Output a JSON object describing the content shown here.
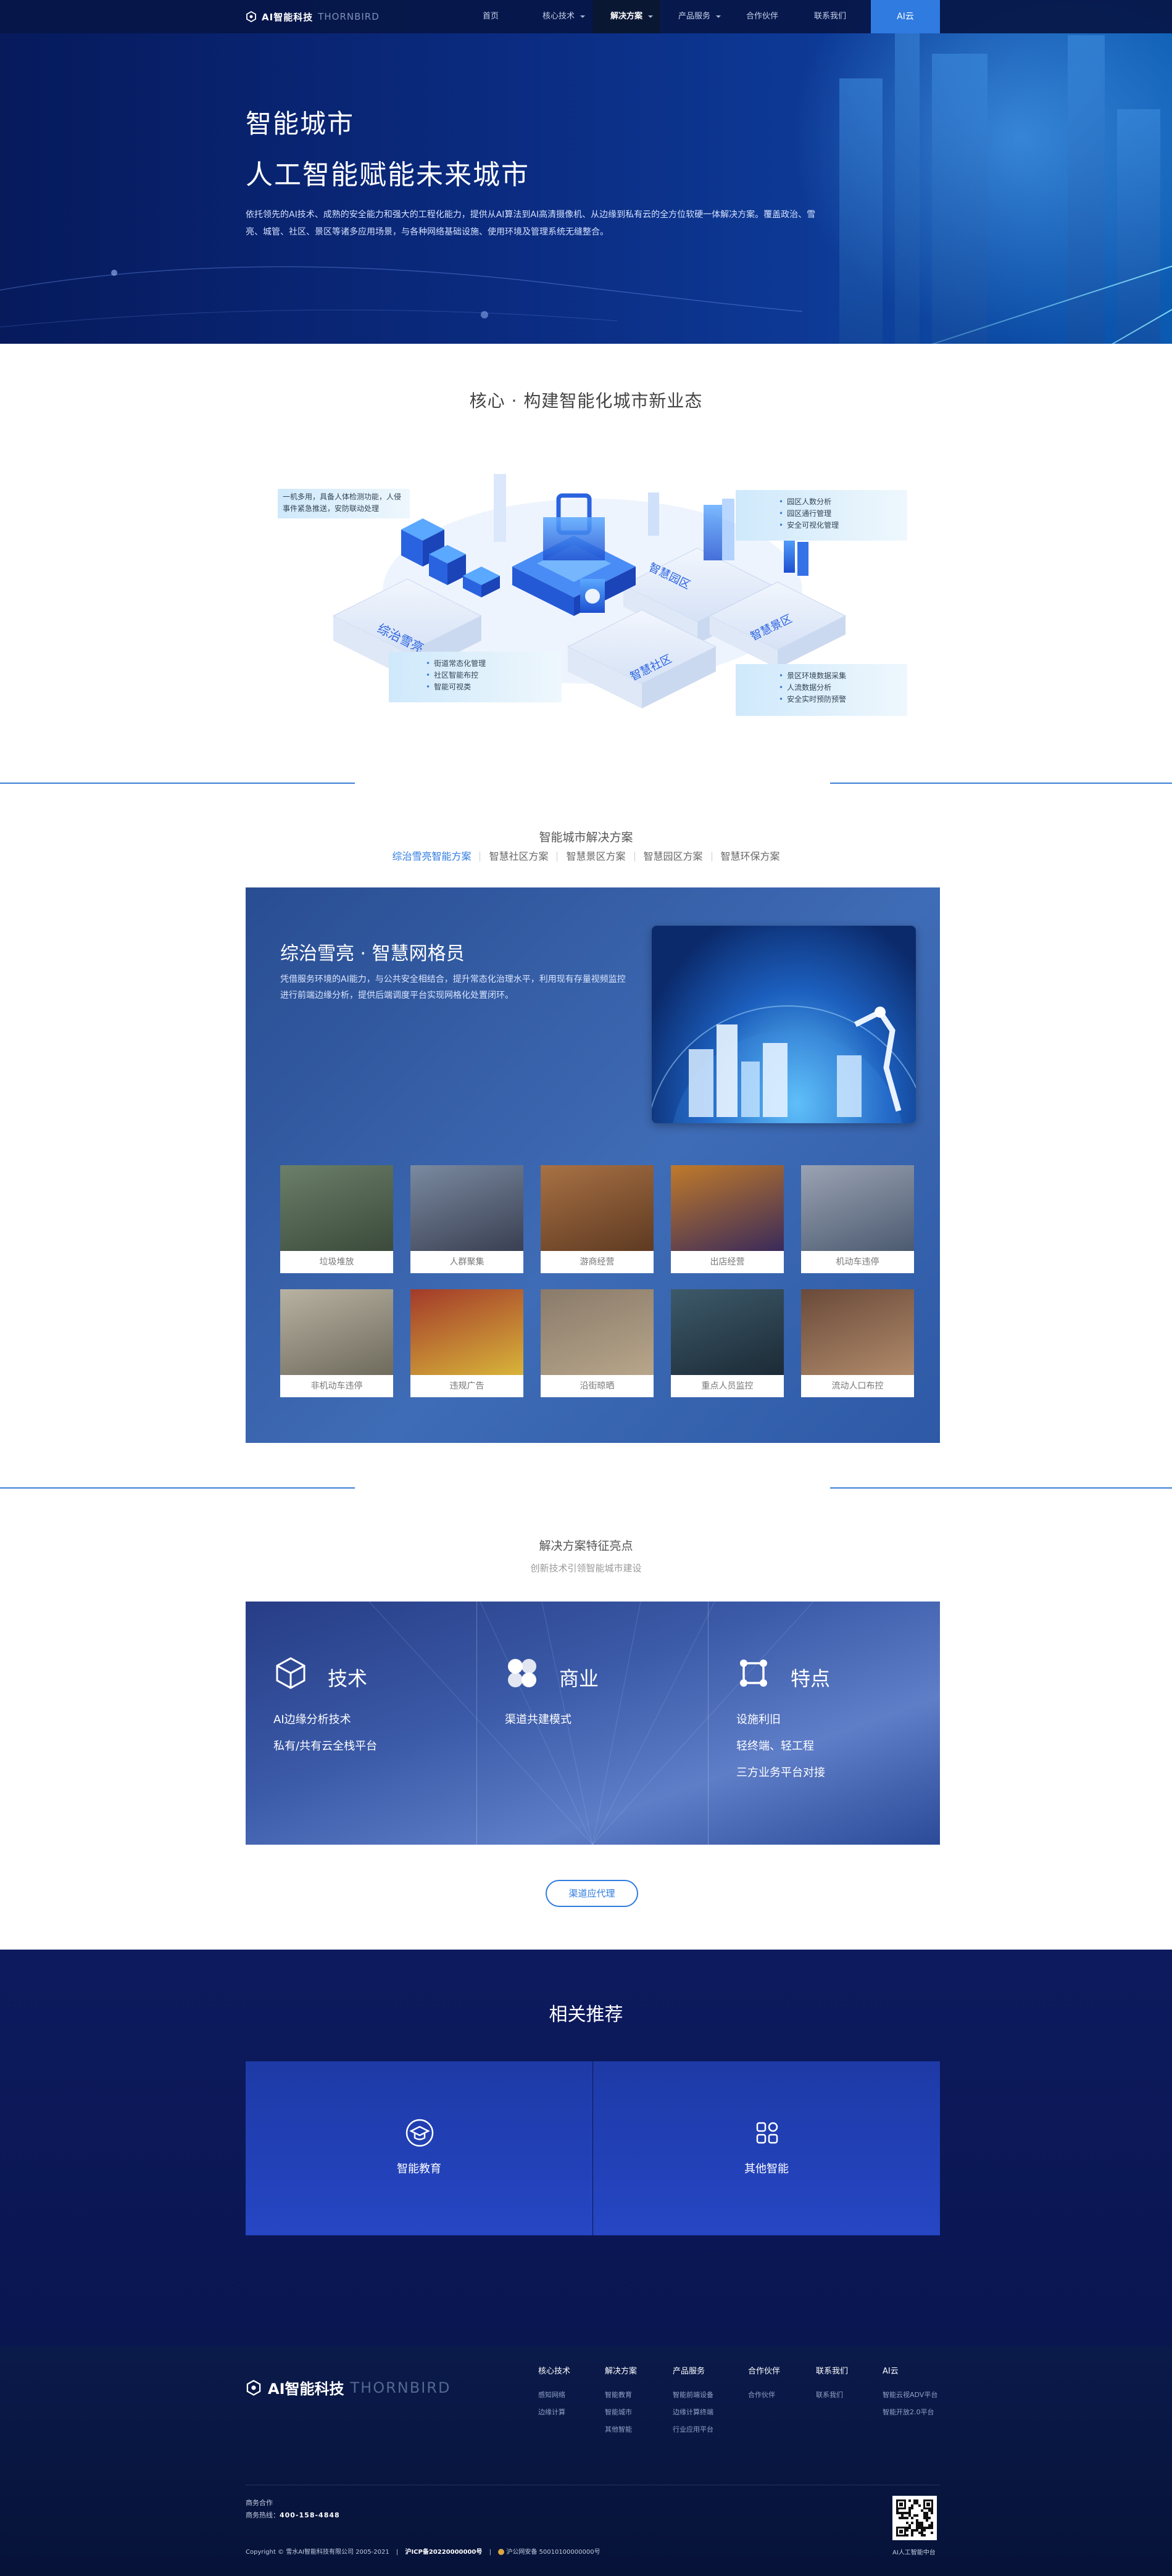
{
  "brand": {
    "name": "AI智能科技",
    "sub": "THORNBIRD"
  },
  "nav": {
    "items": [
      {
        "label": "首页",
        "dropdown": false,
        "active": false
      },
      {
        "label": "核心技术",
        "dropdown": true,
        "active": false
      },
      {
        "label": "解决方案",
        "dropdown": true,
        "active": true
      },
      {
        "label": "产品服务",
        "dropdown": true,
        "active": false
      },
      {
        "label": "合作伙伴",
        "dropdown": false,
        "active": false
      },
      {
        "label": "联系我们",
        "dropdown": false,
        "active": false
      }
    ],
    "cta": "AI云"
  },
  "hero": {
    "title1": "智能城市",
    "title2": "人工智能赋能未来城市",
    "desc": "依托领先的AI技术、成熟的安全能力和强大的工程化能力，提供从AI算法到AI高清摄像机、从边缘到私有云的全方位软硬一体解决方案。覆盖政治、雪亮、城管、社区、景区等诸多应用场景，与各种网络基础设施、使用环境及管理系统无缝整合。"
  },
  "core": {
    "title": "核心 · 构建智能化城市新业态",
    "labels": {
      "a": "综治雪亮",
      "b": "智慧园区",
      "c": "智慧社区",
      "d": "智慧景区"
    },
    "bubble_tl": "一机多用，具备人体检测功能，人侵事件紧急推送，安防联动处理",
    "bubble_tr": [
      "园区人数分析",
      "园区通行管理",
      "安全可视化管理"
    ],
    "bubble_bl": [
      "街道常态化管理",
      "社区智能布控",
      "智能可视类"
    ],
    "bubble_br": [
      "景区环境数据采集",
      "人流数据分析",
      "安全实时预防预警"
    ]
  },
  "solutions": {
    "heading": "智能城市解决方案",
    "tabs": [
      "综治雪亮智能方案",
      "智慧社区方案",
      "智慧景区方案",
      "智慧园区方案",
      "智慧环保方案"
    ],
    "active_tab": 0,
    "card_title": "综治雪亮 · 智慧网格员",
    "card_desc": "凭借服务环境的AI能力，与公共安全相结合，提升常态化治理水平，利用现有存量视频监控进行前端边缘分析，提供后端调度平台实现网格化处置闭环。",
    "items": [
      "垃圾堆放",
      "人群聚集",
      "游商经营",
      "出店经营",
      "机动车违停",
      "非机动车违停",
      "违规广告",
      "沿街晾晒",
      "重点人员监控",
      "流动人口布控"
    ]
  },
  "features": {
    "heading": "解决方案特征亮点",
    "sub": "创新技术引领智能城市建设",
    "cols": [
      {
        "title": "技术",
        "icon": "cube-icon",
        "lines": [
          "AI边缘分析技术",
          "私有/共有云全栈平台"
        ]
      },
      {
        "title": "商业",
        "icon": "clover-icon",
        "lines": [
          "渠道共建模式"
        ]
      },
      {
        "title": "特点",
        "icon": "shield-icon",
        "lines": [
          "设施利旧",
          "轻终端、轻工程",
          "三方业务平台对接"
        ]
      }
    ],
    "button": "渠道应代理"
  },
  "related": {
    "title": "相关推荐",
    "cards": [
      {
        "label": "智能教育",
        "icon": "graduation-icon"
      },
      {
        "label": "其他智能",
        "icon": "apps-icon"
      }
    ]
  },
  "footer": {
    "cols": [
      {
        "title": "核心技术",
        "items": [
          "感知网络",
          "边缘计算"
        ]
      },
      {
        "title": "解决方案",
        "items": [
          "智能教育",
          "智能城市",
          "其他智能"
        ]
      },
      {
        "title": "产品服务",
        "items": [
          "智能前端设备",
          "边缘计算终端",
          "行业应用平台"
        ]
      },
      {
        "title": "合作伙伴",
        "items": [
          "合作伙伴"
        ]
      },
      {
        "title": "联系我们",
        "items": [
          "联系我们"
        ]
      },
      {
        "title": "AI云",
        "items": [
          "智能云视ADV平台",
          "智能开放2.0平台"
        ]
      }
    ],
    "biz_label": "商务合作",
    "hotline_label": "商务热线：",
    "hotline": "400-158-4848",
    "copyright": "Copyright © 雪水AI智能科技有限公司 2005-2021",
    "icp": "沪ICP备20220000000号",
    "police": "沪公网安备 50010100000000号",
    "qr_caption": "AI人工智能中台"
  }
}
